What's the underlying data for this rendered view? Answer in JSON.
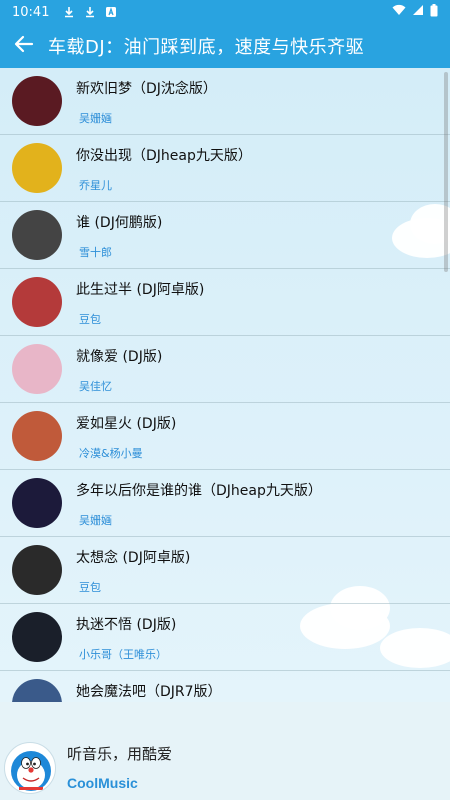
{
  "status_bar": {
    "time": "10:41",
    "icons": [
      "download-icon",
      "download-icon",
      "app-notification-icon",
      "wifi-icon",
      "signal-icon",
      "battery-icon"
    ]
  },
  "app_bar": {
    "title": "车载DJ：油门踩到底，速度与快乐齐驱",
    "back_icon": "arrow-left-icon"
  },
  "songs": [
    {
      "title": "新欢旧梦（DJ沈念版）",
      "artist": "吴姗婳",
      "cover_color": "#5a1a22"
    },
    {
      "title": "你没出现（DJheap九天版）",
      "artist": "乔星儿",
      "cover_color": "#e2b21c"
    },
    {
      "title": "谁 (DJ何鹏版)",
      "artist": "雪十郎",
      "cover_color": "#444444"
    },
    {
      "title": "此生过半 (DJ阿卓版)",
      "artist": "豆包",
      "cover_color": "#b43a3a"
    },
    {
      "title": "就像爱 (DJ版)",
      "artist": "吴佳忆",
      "cover_color": "#e8b6c8"
    },
    {
      "title": "爱如星火 (DJ版)",
      "artist": "冷漠&杨小曼",
      "cover_color": "#c05a3a"
    },
    {
      "title": "多年以后你是谁的谁（DJheap九天版）",
      "artist": "吴姗婳",
      "cover_color": "#1c1a3a"
    },
    {
      "title": "太想念 (DJ阿卓版)",
      "artist": "豆包",
      "cover_color": "#2a2a2a"
    },
    {
      "title": "执迷不悟 (DJ版)",
      "artist": "小乐哥（王唯乐）",
      "cover_color": "#1a1f2a"
    },
    {
      "title": "她会魔法吧（DJR7版）",
      "artist": "",
      "cover_color": "#3a5a8a"
    }
  ],
  "player": {
    "title": "听音乐，用酷爱",
    "subtitle": "CoolMusic",
    "avatar_icon": "doraemon-avatar-icon"
  },
  "colors": {
    "primary": "#29a3e0",
    "artist_text": "#2e8fd8",
    "background": "#d6eef9"
  }
}
